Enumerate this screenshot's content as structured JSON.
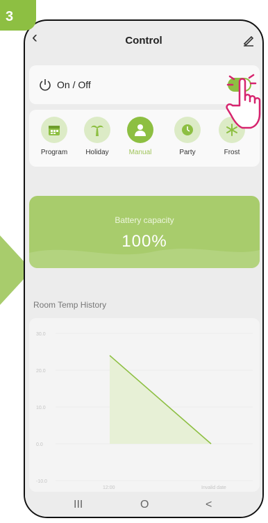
{
  "step": "3",
  "header": {
    "title": "Control"
  },
  "power": {
    "label": "On / Off",
    "state": "on"
  },
  "modes": [
    {
      "label": "Program",
      "icon": "calendar-icon"
    },
    {
      "label": "Holiday",
      "icon": "palm-tree-icon"
    },
    {
      "label": "Manual",
      "icon": "person-icon"
    },
    {
      "label": "Party",
      "icon": "clock-icon"
    },
    {
      "label": "Frost",
      "icon": "snowflake-icon"
    }
  ],
  "battery": {
    "title": "Battery capacity",
    "value": "100%"
  },
  "history": {
    "title": "Room Temp History"
  },
  "chart_data": {
    "type": "area",
    "y_ticks": [
      "30.0",
      "20.0",
      "10.0",
      "0.0",
      "-10.0"
    ],
    "x_ticks": [
      "12:00",
      "Invalid date"
    ],
    "x": [
      "12:00",
      "Invalid date"
    ],
    "series": [
      {
        "values": [
          24.0,
          0.0
        ]
      }
    ],
    "ylim": [
      -10,
      30
    ],
    "colors": {
      "line": "#8dbf42",
      "fill": "#e7f0d6"
    }
  },
  "navbar": {
    "recent": "III",
    "home": "O",
    "back": "<"
  },
  "colors": {
    "accent": "#8dbf42",
    "battery": "#a8cc6c"
  }
}
